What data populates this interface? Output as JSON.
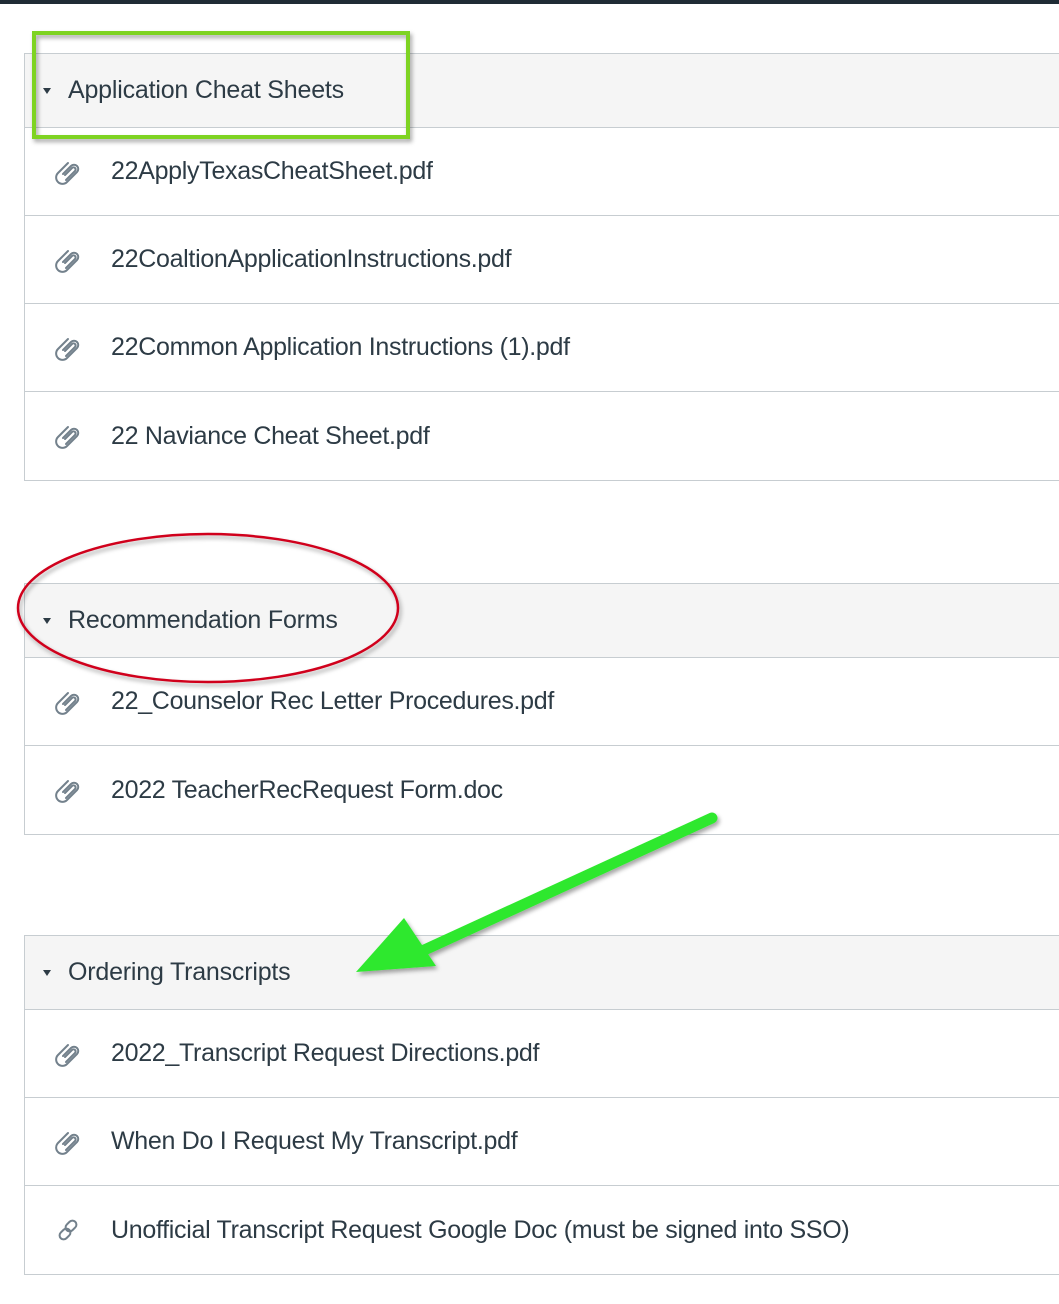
{
  "modules": [
    {
      "title": "Application Cheat Sheets",
      "items": [
        {
          "label": "22ApplyTexasCheatSheet.pdf",
          "icon": "paperclip-icon"
        },
        {
          "label": "22CoaltionApplicationInstructions.pdf",
          "icon": "paperclip-icon"
        },
        {
          "label": "22Common Application Instructions (1).pdf",
          "icon": "paperclip-icon"
        },
        {
          "label": "22 Naviance Cheat Sheet.pdf",
          "icon": "paperclip-icon"
        }
      ]
    },
    {
      "title": "Recommendation Forms",
      "items": [
        {
          "label": "22_Counselor Rec Letter Procedures.pdf",
          "icon": "paperclip-icon"
        },
        {
          "label": "2022 TeacherRecRequest Form.doc",
          "icon": "paperclip-icon"
        }
      ]
    },
    {
      "title": "Ordering Transcripts",
      "items": [
        {
          "label": "2022_Transcript Request Directions.pdf",
          "icon": "paperclip-icon"
        },
        {
          "label": "When Do I Request My Transcript.pdf",
          "icon": "paperclip-icon"
        },
        {
          "label": "Unofficial Transcript Request Google Doc (must be signed into SSO)",
          "icon": "link-icon"
        }
      ]
    }
  ],
  "annotation_colors": {
    "green_box": "#7ed321",
    "red_ellipse": "#d0021b",
    "green_arrow": "#2ee82e"
  }
}
